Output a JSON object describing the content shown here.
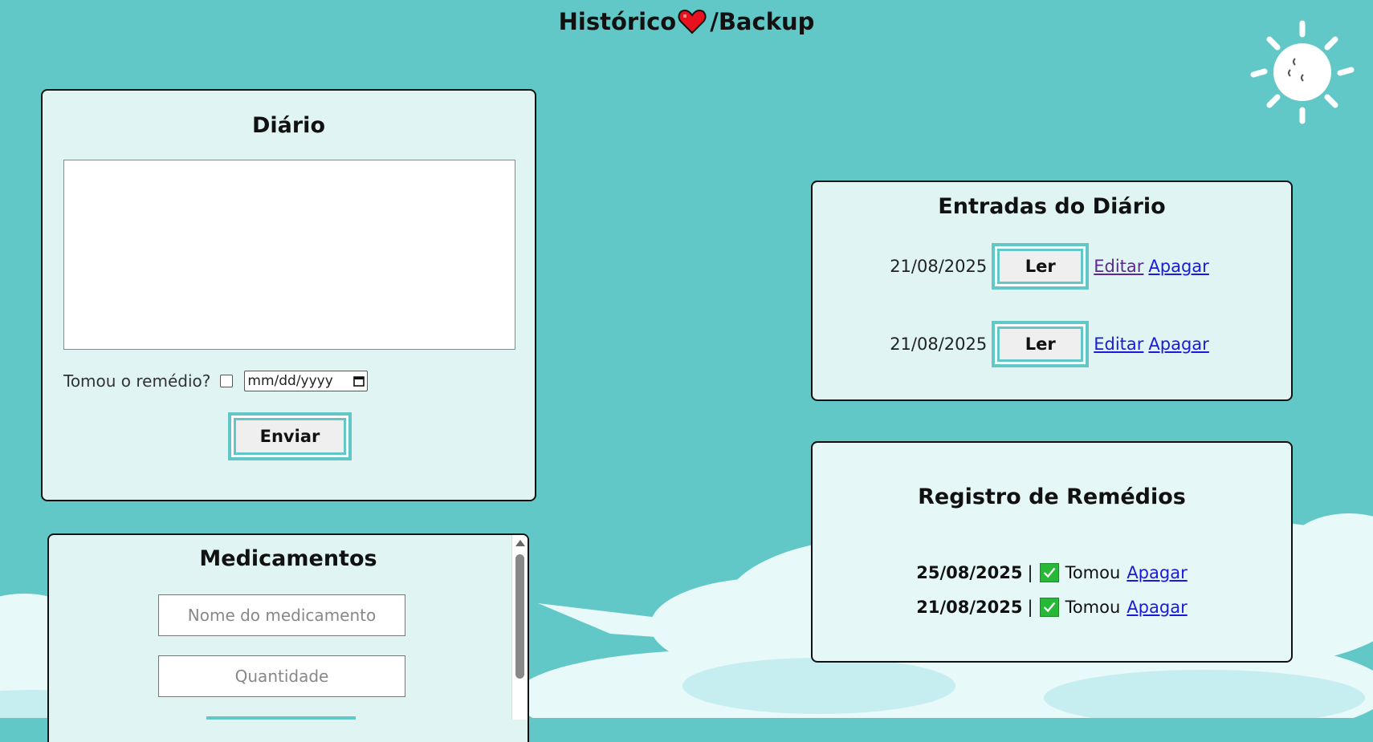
{
  "header": {
    "title_left": "Histórico",
    "title_right": "/Backup"
  },
  "colors": {
    "background": "#62c8c7",
    "card": "#e0f4f4",
    "accent": "#62c8c7",
    "heart": "#e8121e",
    "check": "#27b838",
    "link": "#1a1adb",
    "visited_link": "#5b2a8f"
  },
  "icons": {
    "heart": "heart-icon",
    "sun": "sun-icon",
    "check": "check-icon",
    "calendar": "calendar-icon"
  },
  "diario": {
    "title": "Diário",
    "textarea_value": "",
    "medicine_label": "Tomou o remédio?",
    "date_placeholder": "mm/dd/yyyy",
    "submit_label": "Enviar"
  },
  "medicamentos": {
    "title": "Medicamentos",
    "name_placeholder": "Nome do medicamento",
    "quantity_placeholder": "Quantidade"
  },
  "entradas": {
    "title": "Entradas do Diário",
    "items": [
      {
        "date": "21/08/2025",
        "read_label": "Ler",
        "edit_label": "Editar",
        "delete_label": "Apagar"
      },
      {
        "date": "21/08/2025",
        "read_label": "Ler",
        "edit_label": "Editar",
        "delete_label": "Apagar"
      }
    ]
  },
  "registro": {
    "title": "Registro de Remédios",
    "items": [
      {
        "date": "25/08/2025",
        "separator": "|",
        "status": "Tomou",
        "delete_label": "Apagar"
      },
      {
        "date": "21/08/2025",
        "separator": "|",
        "status": "Tomou",
        "delete_label": "Apagar"
      }
    ]
  }
}
